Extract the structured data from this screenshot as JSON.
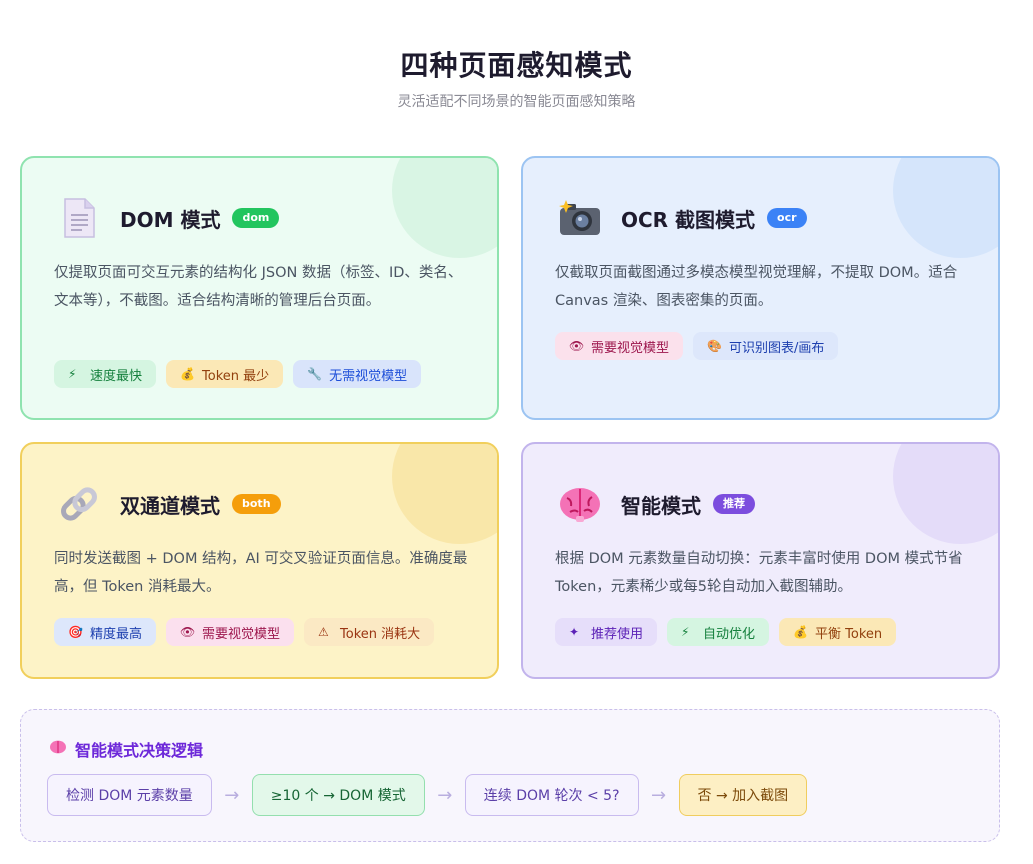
{
  "header": {
    "title": "四种页面感知模式",
    "subtitle": "灵活适配不同场景的智能页面感知策略"
  },
  "cards": {
    "dom": {
      "icon": "document-icon",
      "title": "DOM 模式",
      "tag": "dom",
      "desc": "仅提取页面可交互元素的结构化 JSON 数据（标签、ID、类名、文本等），不截图。适合结构清晰的管理后台页面。",
      "chips": [
        {
          "icon": "⚡",
          "label": "速度最快"
        },
        {
          "icon": "💰",
          "label": "Token 最少"
        },
        {
          "icon": "🔧",
          "label": "无需视觉模型"
        }
      ]
    },
    "ocr": {
      "icon": "camera-icon",
      "title": "OCR 截图模式",
      "tag": "ocr",
      "desc": "仅截取页面截图通过多模态模型视觉理解，不提取 DOM。适合 Canvas 渲染、图表密集的页面。",
      "chips": [
        {
          "icon": "👁",
          "label": "需要视觉模型"
        },
        {
          "icon": "🎨",
          "label": "可识别图表/画布"
        }
      ]
    },
    "both": {
      "icon": "link-icon",
      "title": "双通道模式",
      "tag": "both",
      "desc": "同时发送截图 + DOM 结构，AI 可交叉验证页面信息。准确度最高，但 Token 消耗最大。",
      "chips": [
        {
          "icon": "🎯",
          "label": "精度最高"
        },
        {
          "icon": "👁",
          "label": "需要视觉模型"
        },
        {
          "icon": "⚠",
          "label": "Token 消耗大"
        }
      ]
    },
    "smart": {
      "icon": "brain-icon",
      "title": "智能模式",
      "tag": "推荐",
      "desc": "根据 DOM 元素数量自动切换：元素丰富时使用 DOM 模式节省 Token，元素稀少或每5轮自动加入截图辅助。",
      "chips": [
        {
          "icon": "✦",
          "label": "推荐使用"
        },
        {
          "icon": "⚡",
          "label": "自动优化"
        },
        {
          "icon": "💰",
          "label": "平衡 Token"
        }
      ]
    }
  },
  "decision": {
    "icon": "brain-icon",
    "title": "智能模式决策逻辑",
    "steps": [
      "检测 DOM 元素数量",
      "≥10 个 → DOM 模式",
      "连续 DOM 轮次 < 5?",
      "否 → 加入截图"
    ],
    "arrow": "→"
  },
  "colors": {
    "dom": "#22c55e",
    "ocr": "#3b82f6",
    "both": "#f59e0b",
    "smart": "#7c4dde"
  }
}
